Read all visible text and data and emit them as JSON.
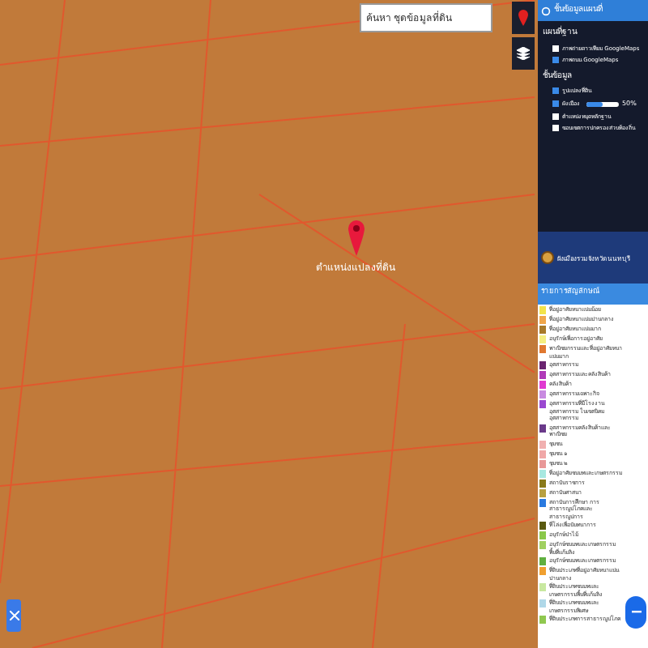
{
  "search": {
    "placeholder": "ค้นหา ชุดข้อมูลที่ดิน"
  },
  "map": {
    "marker_label": "ตำแหน่งแปลงที่ดิน"
  },
  "panel": {
    "title": "ชั้นข้อมูลแผนที่",
    "base_heading": "แผนที่ฐาน",
    "base_maps": [
      {
        "label": "ภาพถ่ายดาวเทียม GoogleMaps",
        "selected": false
      },
      {
        "label": "ภาพถนน GoogleMaps",
        "selected": true
      }
    ],
    "layers_heading": "ชั้นข้อมูล",
    "layers": [
      {
        "label": "รูปแปลงที่ดิน",
        "checked": true,
        "kind": "plain"
      },
      {
        "label": "ผังเมือง",
        "checked": true,
        "kind": "slider",
        "level": 0.5,
        "reading": "50%"
      },
      {
        "label": "ตำแหน่งหมุดหลักฐาน",
        "checked": false,
        "kind": "plain"
      },
      {
        "label": "ขอบเขตการปกครองส่วนท้องถิ่น",
        "checked": false,
        "kind": "plain"
      }
    ],
    "plan_title": "ผังเมืองรวมจังหวัดนนทบุรี"
  },
  "legend": {
    "title": "รายการสัญลักษณ์",
    "items": [
      {
        "label": "ที่อยู่อาศัยหนาแน่นน้อย",
        "color": "#f2e34a"
      },
      {
        "label": "ที่อยู่อาศัยหนาแน่นปานกลาง",
        "color": "#f0a64a"
      },
      {
        "label": "ที่อยู่อาศัยหนาแน่นมาก",
        "color": "#a87a2a"
      },
      {
        "label": "อนุรักษ์เพื่อการอยู่อาศัย",
        "color": "#f5ee80"
      },
      {
        "label": "พาณิชยกรรมและที่อยู่อาศัยหนาแน่นมาก",
        "color": "#e07830"
      },
      {
        "label": "อุตสาหกรรม",
        "color": "#6a2470"
      },
      {
        "label": "อุตสาหกรรมและคลังสินค้า",
        "color": "#b03ab8"
      },
      {
        "label": "คลังสินค้า",
        "color": "#e03ad0"
      },
      {
        "label": "อุตสาหกรรมเฉพาะกิจ",
        "color": "#c88ae0"
      },
      {
        "label": "อุตสาหกรรมที่มีโรงงานอุตสาหกรรม ในเขตนิคมอุตสาหกรรม",
        "color": "#9a48d0"
      },
      {
        "label": "อุตสาหกรรมคลังสินค้าและพาณิชย",
        "color": "#6a3a8a"
      },
      {
        "label": "ชุมชน",
        "color": "#f0b0b0"
      },
      {
        "label": "ชุมชน ๑",
        "color": "#f0a8a8"
      },
      {
        "label": "ชุมชน ๒",
        "color": "#e89898"
      },
      {
        "label": "ที่อยู่อาศัยชนบทและเกษตรกรรม",
        "color": "#a8e8e0"
      },
      {
        "label": "สถาบันราชการ",
        "color": "#8a7a1a"
      },
      {
        "label": "สถาบันศาสนา",
        "color": "#b8a040"
      },
      {
        "label": "สถาบันการศึกษา การสาธารณูปโภคและสาธารณูปการ",
        "color": "#2a7ae0"
      },
      {
        "label": "ที่โล่งเพื่อนันทนาการ",
        "color": "#5a5a10"
      },
      {
        "label": "อนุรักษ์ป่าไม้",
        "color": "#8ac84a"
      },
      {
        "label": "อนุรักษ์ชนบทและเกษตรกรรมพื้นที่แก้มลิง",
        "color": "#a0d060"
      },
      {
        "label": "อนุรักษ์ชนบทและเกษตรกรรม",
        "color": "#60b040"
      },
      {
        "label": "ที่ดินประเภทที่อยู่อาศัยหนาแน่นปานกลาง",
        "color": "#f0a030"
      },
      {
        "label": "ที่ดินประเภทชนบทและเกษตรกรรมพื้นที่แก้มลิง",
        "color": "#c8e8a0"
      },
      {
        "label": "ที่ดินประเภทชนบทและเกษตรกรรมพิเศษ",
        "color": "#b0d8e8"
      },
      {
        "label": "ที่ดินประเภทการสาธารณูปโภค",
        "color": "#90c850"
      }
    ]
  }
}
